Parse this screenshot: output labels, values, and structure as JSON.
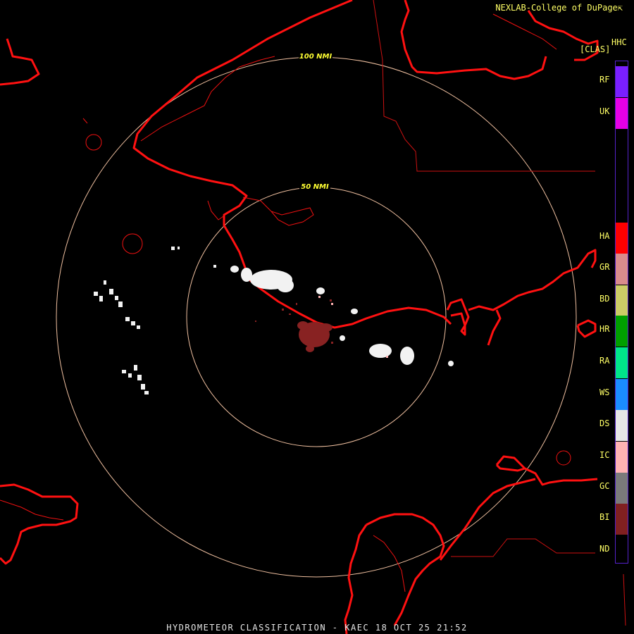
{
  "header": {
    "credit": "NEXLAB-College of DuPage",
    "credit_mark": "⇱",
    "product_code": "HHC",
    "product_tag": "[CLAS]"
  },
  "range_rings": [
    {
      "label": "50 NMI",
      "nmi": 50
    },
    {
      "label": "100 NMI",
      "nmi": 100
    }
  ],
  "legend": {
    "classes": [
      {
        "code": "RF",
        "color": "#7a1fff"
      },
      {
        "code": "UK",
        "color": "#e600e6"
      },
      {
        "code": "HA",
        "color": "#ff0000"
      },
      {
        "code": "GR",
        "color": "#d98c8c"
      },
      {
        "code": "BD",
        "color": "#cccc66"
      },
      {
        "code": "HR",
        "color": "#00a000"
      },
      {
        "code": "RA",
        "color": "#00e68a"
      },
      {
        "code": "WS",
        "color": "#1a8cff"
      },
      {
        "code": "DS",
        "color": "#e6e6e6"
      },
      {
        "code": "IC",
        "color": "#ffb3b3"
      },
      {
        "code": "GC",
        "color": "#7a7a7a"
      },
      {
        "code": "BI",
        "color": "#802020"
      },
      {
        "code": "ND",
        "color": "#000000"
      }
    ]
  },
  "footer": {
    "title": "HYDROMETEOR CLASSIFICATION - KAEC 18 OCT 25 21:52"
  }
}
